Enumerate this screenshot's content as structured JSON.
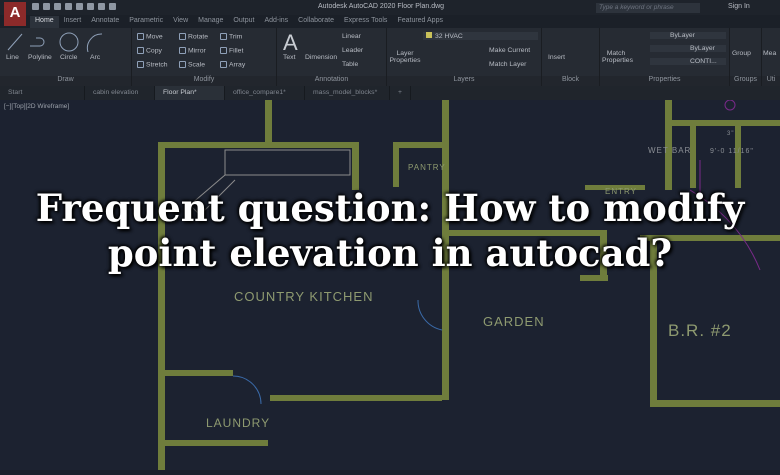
{
  "app": {
    "title": "Autodesk AutoCAD 2020   Floor Plan.dwg",
    "logo": "A",
    "search_placeholder": "Type a keyword or phrase",
    "sign_in": "Sign In"
  },
  "ribbon_tabs": [
    "Home",
    "Insert",
    "Annotate",
    "Parametric",
    "View",
    "Manage",
    "Output",
    "Add-ins",
    "Collaborate",
    "Express Tools",
    "Featured Apps"
  ],
  "panels": {
    "draw": {
      "label": "Draw",
      "tools": [
        "Line",
        "Polyline",
        "Circle",
        "Arc"
      ]
    },
    "modify": {
      "label": "Modify",
      "tools": [
        "Move",
        "Rotate",
        "Trim",
        "Copy",
        "Mirror",
        "Fillet",
        "Stretch",
        "Scale",
        "Array"
      ]
    },
    "annotation": {
      "label": "Annotation",
      "tools": [
        "Text",
        "Dimension",
        "Linear",
        "Leader",
        "Table"
      ]
    },
    "layers": {
      "label": "Layers",
      "tools": [
        "Layer Properties",
        "Make Current",
        "Match Layer"
      ],
      "current_layer": "32 HVAC"
    },
    "block": {
      "label": "Block",
      "tools": [
        "Insert"
      ]
    },
    "properties": {
      "label": "Properties",
      "tools": [
        "Match Properties"
      ],
      "color": "ByLayer",
      "lineweight": "ByLayer",
      "linetype": "CONTI..."
    },
    "groups": {
      "label": "Groups",
      "tools": [
        "Group"
      ]
    },
    "utilities": {
      "label": "Uti",
      "tools": [
        "Mea"
      ]
    }
  },
  "doc_tabs": [
    {
      "label": "Start",
      "active": false
    },
    {
      "label": "cabin elevation",
      "active": false
    },
    {
      "label": "Floor Plan*",
      "active": true
    },
    {
      "label": "office_compare1*",
      "active": false
    },
    {
      "label": "mass_model_blocks*",
      "active": false
    }
  ],
  "viewport_label": "[−][Top][2D Wireframe]",
  "rooms": [
    "PANTRY",
    "WET BAR",
    "9'-0 11/16\"",
    "3\"",
    "ENTRY",
    "COUNTRY KITCHEN",
    "GARDEN",
    "B.R. #2",
    "LAUNDRY"
  ],
  "headline": "Frequent question: How to modify point elevation in autocad?",
  "colors": {
    "wall": "#6f7d3c",
    "background": "#1c2230",
    "accent_magenta": "#7a2a8a"
  }
}
